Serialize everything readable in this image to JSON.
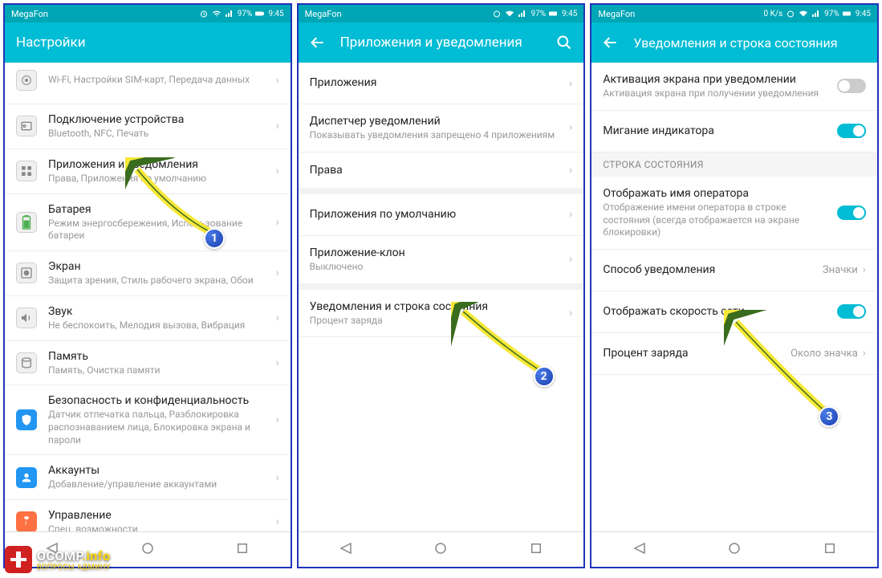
{
  "statusbar": {
    "carrier": "MegaFon",
    "battery": "97%",
    "time": "9:45",
    "speed": "0 K/s"
  },
  "screen1": {
    "header": "Настройки",
    "items": [
      {
        "title": "Wi-Fi, Настройки SIM-карт, Передача данных",
        "sub": ""
      },
      {
        "title": "Подключение устройства",
        "sub": "Bluetooth, NFC, Печать"
      },
      {
        "title": "Приложения и уведомления",
        "sub": "Права, Приложения по умолчанию"
      },
      {
        "title": "Батарея",
        "sub": "Режим энергосбережения, Использование батареи"
      },
      {
        "title": "Экран",
        "sub": "Защита зрения, Стиль рабочего экрана, Обои"
      },
      {
        "title": "Звук",
        "sub": "Не беспокоить, Мелодия вызова, Вибрация"
      },
      {
        "title": "Память",
        "sub": "Память, Очистка памяти"
      },
      {
        "title": "Безопасность и конфиденциальность",
        "sub": "Датчик отпечатка пальца, Разблокировка распознаванием лица, Блокировка экрана и пароли"
      },
      {
        "title": "Аккаунты",
        "sub": "Добавление/управление аккаунтами"
      },
      {
        "title": "Управление",
        "sub": "Спец. возможности"
      }
    ]
  },
  "screen2": {
    "header": "Приложения и уведомления",
    "items": [
      {
        "title": "Приложения",
        "sub": ""
      },
      {
        "title": "Диспетчер уведомлений",
        "sub": "Показывать уведомления запрещено 4 приложениям"
      },
      {
        "title": "Права",
        "sub": ""
      },
      {
        "title": "Приложения по умолчанию",
        "sub": ""
      },
      {
        "title": "Приложение-клон",
        "sub": "Выключено"
      },
      {
        "title": "Уведомления и строка состояния",
        "sub": "Процент заряда"
      }
    ]
  },
  "screen3": {
    "header": "Уведомления и строка состояния",
    "items": [
      {
        "title": "Активация экрана при уведомлении",
        "sub": "Активация экрана при получении уведомления",
        "toggle": false
      },
      {
        "title": "Мигание индикатора",
        "sub": "",
        "toggle": true
      }
    ],
    "section": "СТРОКА СОСТОЯНИЯ",
    "items2": [
      {
        "title": "Отображать имя оператора",
        "sub": "Отображение имени оператора в строке состояния (всегда отображается на экране блокировки)",
        "toggle": true
      },
      {
        "title": "Способ уведомления",
        "value": "Значки"
      },
      {
        "title": "Отображать скорость сети",
        "toggle": true
      },
      {
        "title": "Процент заряда",
        "value": "Около значка"
      }
    ]
  },
  "annotations": {
    "b1": "1",
    "b2": "2",
    "b3": "3"
  },
  "watermark": {
    "brand": "OCOMP",
    "suffix": ".info",
    "sub": "ВОПРОСЫ АДМИНУ"
  }
}
